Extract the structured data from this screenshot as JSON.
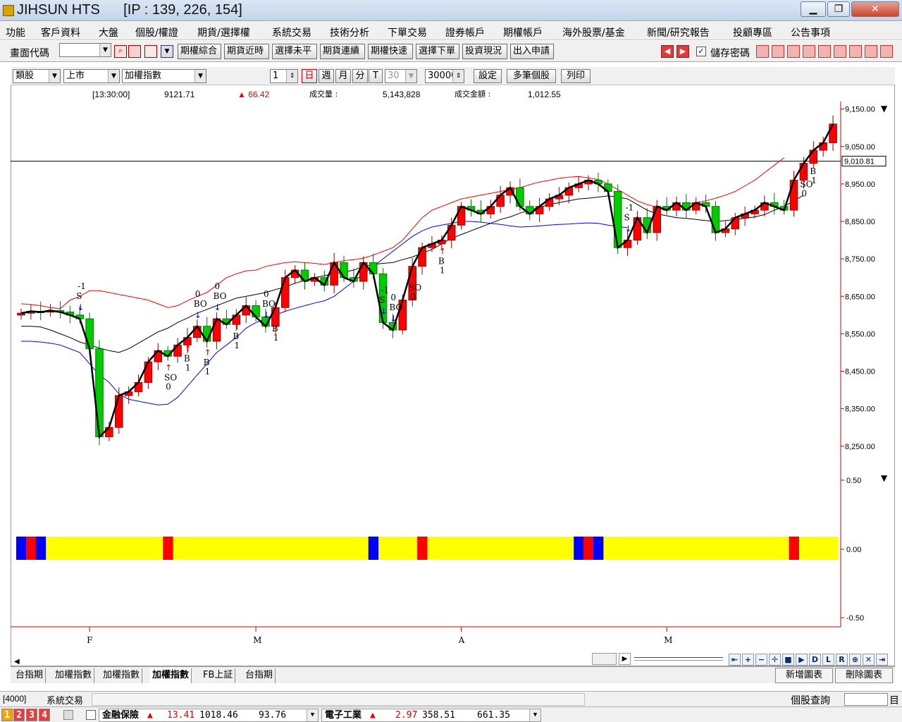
{
  "window": {
    "title": "JIHSUN HTS",
    "ip": "[IP : 139, 226, 154]",
    "minimize": "▁",
    "maximize": "❐",
    "close": "✕"
  },
  "menu": [
    "功能",
    "客戶資料",
    "大盤",
    "個股/權證",
    "期貨/選擇權",
    "系統交易",
    "技術分析",
    "下單交易",
    "證券帳戶",
    "期權帳戶",
    "海外股票/基金",
    "新聞/研究報告",
    "投顧專區",
    "公告事項"
  ],
  "toolbar": {
    "code_label": "畫面代碼",
    "code_value": "",
    "buttons": [
      "期權綜合",
      "期貨近時",
      "選擇未平",
      "期貨連續",
      "期權快速",
      "選擇下單",
      "投資現況",
      "出入申請"
    ],
    "save_password_label": "儲存密碼",
    "save_password_checked": true,
    "icons": [
      "search-icon",
      "folder-icon",
      "chart-icon",
      "dropdown-icon"
    ]
  },
  "controls": {
    "category": "類股",
    "market": "上市",
    "index": "加權指數",
    "period_count": "1",
    "periods": [
      "日",
      "週",
      "月",
      "分"
    ],
    "active_period": "日",
    "T_label": "T",
    "minutes": "30",
    "bars": "30000",
    "settings_button": "設定",
    "multi_button": "多筆個股",
    "print_button": "列印"
  },
  "info": {
    "time": "[13:30:00]",
    "price": "9121.71",
    "change": "▲ 66.42",
    "volume_label": "成交量  :",
    "volume": "5,143,828",
    "amount_label": "成交金額  :",
    "amount": "1,012.55"
  },
  "chart_data": {
    "type": "candlestick",
    "title": "",
    "y_ticks": [
      "9,150.00",
      "9,050.00",
      "8,950.00",
      "8,850.00",
      "8,750.00",
      "8,650.00",
      "8,550.00",
      "8,450.00",
      "8,350.00",
      "8,250.00"
    ],
    "y_range": [
      8210,
      9170
    ],
    "current_price_label": "9,010.81",
    "current_price": 9010.81,
    "x_labels": [
      {
        "label": "F",
        "index": 7
      },
      {
        "label": "M",
        "index": 24
      },
      {
        "label": "A",
        "index": 45
      },
      {
        "label": "M",
        "index": 66
      }
    ],
    "closes": [
      8605,
      8610,
      8608,
      8612,
      8608,
      8600,
      8590,
      8510,
      8275,
      8300,
      8385,
      8395,
      8420,
      8475,
      8505,
      8490,
      8520,
      8540,
      8570,
      8530,
      8590,
      8575,
      8600,
      8625,
      8595,
      8570,
      8620,
      8700,
      8720,
      8690,
      8700,
      8680,
      8740,
      8700,
      8690,
      8740,
      8710,
      8580,
      8560,
      8640,
      8730,
      8780,
      8790,
      8800,
      8840,
      8890,
      8880,
      8870,
      8890,
      8920,
      8940,
      8890,
      8870,
      8890,
      8910,
      8920,
      8940,
      8950,
      8960,
      8950,
      8930,
      8780,
      8800,
      8860,
      8820,
      8890,
      8880,
      8900,
      8880,
      8900,
      8890,
      8820,
      8830,
      8860,
      8870,
      8880,
      8900,
      8890,
      8880,
      8960,
      9005,
      9040,
      9060,
      9110
    ],
    "moving_average": [
      8570,
      8570,
      8568,
      8560,
      8550,
      8540,
      8528,
      8520,
      8512,
      8505,
      8500,
      8510,
      8525,
      8540,
      8555,
      8565,
      8580,
      8592,
      8605,
      8615,
      8625,
      8635,
      8645,
      8650,
      8655,
      8660,
      8668,
      8675,
      8685,
      8692,
      8700,
      8705,
      8710,
      8715,
      8720,
      8730,
      8735,
      8738,
      8740,
      8748,
      8755,
      8765,
      8775,
      8790,
      8805,
      8815,
      8825,
      8835,
      8845,
      8855,
      8862,
      8872,
      8880,
      8888,
      8895,
      8900,
      8905,
      8910,
      8912,
      8915,
      8918,
      8915,
      8910,
      8895,
      8880,
      8870,
      8865,
      8860,
      8858,
      8855,
      8852,
      8850,
      8852,
      8855,
      8858,
      8862,
      8868,
      8880,
      8890,
      8905,
      8920
    ],
    "upper_band": [
      8630,
      8628,
      8625,
      8620,
      8617,
      8640,
      8650,
      8665,
      8665,
      8660,
      8655,
      8650,
      8645,
      8640,
      8630,
      8620,
      8625,
      8638,
      8650,
      8660,
      8680,
      8700,
      8710,
      8718,
      8720,
      8730,
      8735,
      8740,
      8742,
      8740,
      8738,
      8735,
      8740,
      8745,
      8748,
      8752,
      8760,
      8770,
      8780,
      8800,
      8830,
      8860,
      8880,
      8890,
      8900,
      8910,
      8915,
      8920,
      8925,
      8930,
      8935,
      8940,
      8948,
      8955,
      8960,
      8965,
      8968,
      8970,
      8966,
      8962,
      8950,
      8935,
      8920,
      8905,
      8895,
      8888,
      8885,
      8890,
      8895,
      8900,
      8905,
      8912,
      8920,
      8930,
      8945,
      8960,
      8980,
      9000,
      9020
    ],
    "lower_band": [
      8530,
      8530,
      8528,
      8525,
      8520,
      8510,
      8500,
      8470,
      8440,
      8420,
      8390,
      8375,
      8370,
      8365,
      8360,
      8362,
      8380,
      8410,
      8440,
      8470,
      8500,
      8520,
      8540,
      8565,
      8580,
      8590,
      8600,
      8610,
      8618,
      8625,
      8632,
      8638,
      8650,
      8670,
      8690,
      8710,
      8730,
      8750,
      8770,
      8790,
      8810,
      8825,
      8835,
      8840,
      8845,
      8850,
      8850,
      8848,
      8845,
      8842,
      8838,
      8835,
      8836,
      8838,
      8840,
      8842,
      8843,
      8845,
      8846,
      8845,
      8840,
      8836,
      8833
    ],
    "signals": [
      {
        "index": 6,
        "type": "S",
        "label": "-1"
      },
      {
        "index": 15,
        "type": "SO",
        "label": "0"
      },
      {
        "index": 17,
        "type": "B",
        "label": "1"
      },
      {
        "index": 18,
        "type": "BO",
        "label": "0"
      },
      {
        "index": 19,
        "type": "B",
        "label": "1"
      },
      {
        "index": 20,
        "type": "BO",
        "label": "0"
      },
      {
        "index": 22,
        "type": "B",
        "label": "1"
      },
      {
        "index": 25,
        "type": "BO",
        "label": "0"
      },
      {
        "index": 26,
        "type": "B",
        "label": "1"
      },
      {
        "index": 37,
        "type": "S",
        "label": "-1"
      },
      {
        "index": 38,
        "type": "BO",
        "label": "0"
      },
      {
        "index": 40,
        "type": "SO",
        "label": "0"
      },
      {
        "index": 43,
        "type": "B",
        "label": "1"
      },
      {
        "index": 62,
        "type": "S",
        "label": "-1"
      },
      {
        "index": 80,
        "type": "SO",
        "label": "0"
      },
      {
        "index": 81,
        "type": "B",
        "label": "1"
      }
    ],
    "indicator": {
      "y_ticks": [
        "0.50",
        "0.00",
        "-0.50"
      ],
      "colors": {
        "neutral": "#ffff00",
        "long": "#ff0000",
        "short": "#0000ff"
      },
      "segments": [
        {
          "index": 0,
          "state": "short"
        },
        {
          "index": 1,
          "state": "long"
        },
        {
          "index": 2,
          "state": "short"
        },
        {
          "index": 15,
          "state": "long"
        },
        {
          "index": 36,
          "state": "short"
        },
        {
          "index": 41,
          "state": "long"
        },
        {
          "index": 57,
          "state": "short"
        },
        {
          "index": 58,
          "state": "long"
        },
        {
          "index": 59,
          "state": "short"
        },
        {
          "index": 79,
          "state": "long"
        }
      ]
    }
  },
  "tabs": [
    "台指期",
    "加權指數",
    "加權指數",
    "加權指數",
    "FB上証",
    "台指期"
  ],
  "active_tab": 3,
  "right_buttons": {
    "add_chart": "新增圖表",
    "delete_chart": "刪除圖表"
  },
  "scroll_buttons": [
    "⇤",
    "+",
    "−",
    "✛",
    "■",
    "▶",
    "D",
    "L",
    "R",
    "⊕",
    "✕",
    "⇥"
  ],
  "status": {
    "code": "[4000]",
    "name": "系統交易",
    "query_label": "個股查詢",
    "query_value": ""
  },
  "bottom": {
    "numbers": [
      "1",
      "2",
      "3",
      "4"
    ],
    "ticker1": {
      "name": "金融保險",
      "arrow": "▲",
      "change": "13.41",
      "value": "1018.46",
      "amount": "93.76"
    },
    "ticker2": {
      "name": "電子工業",
      "arrow": "▲",
      "change": "2.97",
      "value": "358.51",
      "amount": "661.35"
    }
  },
  "colors": {
    "up": "#ff0000",
    "down": "#00cc00",
    "ma": "#000000",
    "upper": "#ff0000",
    "lower": "#0000ff",
    "price_line": "#000000"
  }
}
